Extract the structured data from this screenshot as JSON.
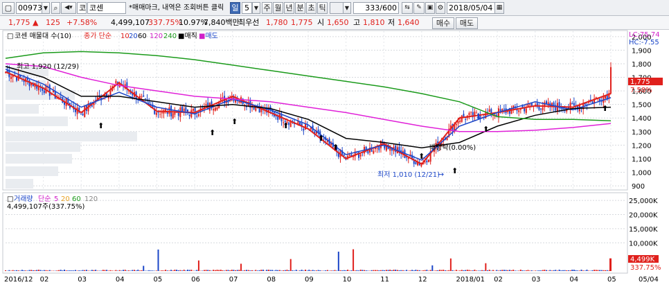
{
  "toolbar": {
    "code": "009730",
    "code_type": "코",
    "stock_name": "코센",
    "notice": "*매매마크, 내역은 조회버튼 클릭",
    "periods": [
      "일",
      "5",
      "주",
      "월",
      "년",
      "분",
      "초",
      "틱"
    ],
    "active_period": "일",
    "count": "333",
    "count_total": "/600",
    "date": "2018/05/04"
  },
  "quote": {
    "price": "1,775",
    "change": "125",
    "change_pct": "+7.58%",
    "volume": "4,499,107",
    "volume_ratio": "337.75%",
    "turnover": "10.97%",
    "amount": "7,840백만",
    "pref_label": "최우선",
    "ask": "1,780",
    "bid": "1,775",
    "open_label": "시",
    "open": "1,650",
    "high_label": "고",
    "high": "1,810",
    "low_label": "저",
    "low": "1,640",
    "buy_label": "매수",
    "sell_label": "매도"
  },
  "price_legend": {
    "name": "코센 매물대 수(10)",
    "ma_prefix": "종가 단순",
    "ma_periods": [
      "10",
      "20",
      "60",
      "120",
      "240"
    ],
    "b1": "매직",
    "b2": "매도"
  },
  "price_axis": {
    "lc": "LC:75.74",
    "hc": "HC:-7.55",
    "ticks": [
      "2,000",
      "1,900",
      "1,800",
      "1,700",
      "1,600",
      "1,500",
      "1,400",
      "1,300",
      "1,200",
      "1,100",
      "1,000",
      "900"
    ],
    "current": "1,775",
    "current_pct": "7.58%"
  },
  "annotations": {
    "high": "최고 1,920 (12/29)",
    "low": "최저 1,010 (12/21)",
    "dividend": "배당락(0.00%)"
  },
  "volume_legend": {
    "label": "거래량",
    "ma_prefix": "단순",
    "ma_periods": [
      "5",
      "20",
      "60",
      "120"
    ],
    "value": "4,499,107주(337.75%)"
  },
  "volume_axis": {
    "ticks": [
      "25,000K",
      "20,000K",
      "15,000K",
      "10,000K"
    ],
    "current": "4,499K",
    "current_pct": "337.75%"
  },
  "x_axis": {
    "labels": [
      "2016/12",
      "02",
      "03",
      "04",
      "05",
      "06",
      "07",
      "08",
      "09",
      "10",
      "11",
      "12",
      "2018/01",
      "02",
      "03",
      "04",
      "05",
      "05/04"
    ]
  },
  "colors": {
    "up": "#e0201c",
    "down": "#1b46c8",
    "ma10": "#e0201c",
    "ma20": "#1b46c8",
    "ma60": "#000000",
    "ma120": "#e020d8",
    "ma240": "#1a9a1a"
  },
  "chart_data": {
    "type": "line",
    "title": "코센",
    "x": [
      "2016/12",
      "02",
      "03",
      "04",
      "05",
      "06",
      "07",
      "08",
      "09",
      "10",
      "11",
      "12",
      "2018/01",
      "02",
      "03",
      "04",
      "05"
    ],
    "series": [
      {
        "name": "10",
        "values": [
          1740,
          1620,
          1440,
          1660,
          1450,
          1440,
          1560,
          1440,
          1320,
          1100,
          1210,
          1060,
          1400,
          1440,
          1490,
          1480,
          1580
        ]
      },
      {
        "name": "20",
        "values": [
          1760,
          1650,
          1480,
          1590,
          1480,
          1430,
          1540,
          1460,
          1350,
          1130,
          1200,
          1090,
          1340,
          1440,
          1520,
          1460,
          1550
        ]
      },
      {
        "name": "60",
        "values": [
          1780,
          1700,
          1560,
          1560,
          1520,
          1480,
          1500,
          1470,
          1390,
          1250,
          1220,
          1180,
          1220,
          1340,
          1420,
          1470,
          1480
        ]
      },
      {
        "name": "120",
        "values": [
          1800,
          1780,
          1700,
          1640,
          1600,
          1560,
          1540,
          1520,
          1480,
          1440,
          1390,
          1340,
          1300,
          1300,
          1310,
          1330,
          1360
        ]
      },
      {
        "name": "240",
        "values": [
          1840,
          1880,
          1890,
          1880,
          1860,
          1830,
          1790,
          1750,
          1710,
          1670,
          1630,
          1580,
          1520,
          1410,
          1390,
          1390,
          1380
        ]
      }
    ],
    "ylim": [
      880,
      2040
    ],
    "volume_ylim": [
      0,
      27500
    ],
    "volume_unit": "K"
  }
}
